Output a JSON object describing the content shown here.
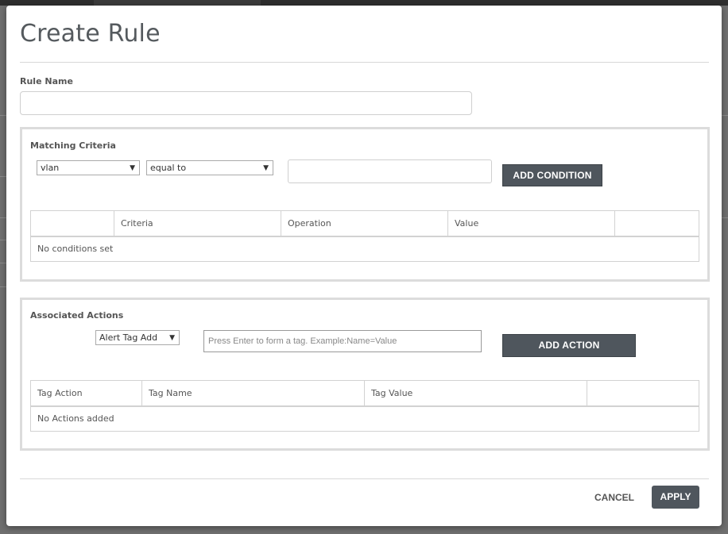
{
  "dialog": {
    "title": "Create Rule",
    "rule_name_label": "Rule Name",
    "rule_name_value": ""
  },
  "matching": {
    "title": "Matching Criteria",
    "field_select": "vlan",
    "operation_select": "equal to",
    "value_input": "",
    "add_button": "ADD CONDITION",
    "columns": [
      "",
      "Criteria",
      "Operation",
      "Value",
      ""
    ],
    "empty_text": "No conditions set"
  },
  "actions": {
    "title": "Associated Actions",
    "action_select": "Alert Tag Add",
    "tag_placeholder": "Press Enter to form a tag. Example:Name=Value",
    "add_button": "ADD ACTION",
    "columns": [
      "Tag Action",
      "Tag Name",
      "Tag Value",
      ""
    ],
    "empty_text": "No Actions added"
  },
  "footer": {
    "cancel": "CANCEL",
    "apply": "APPLY"
  },
  "icons": {
    "dropdown": "▼"
  },
  "colors": {
    "button_dark": "#4f565d",
    "section_border": "#dcdcdc"
  }
}
